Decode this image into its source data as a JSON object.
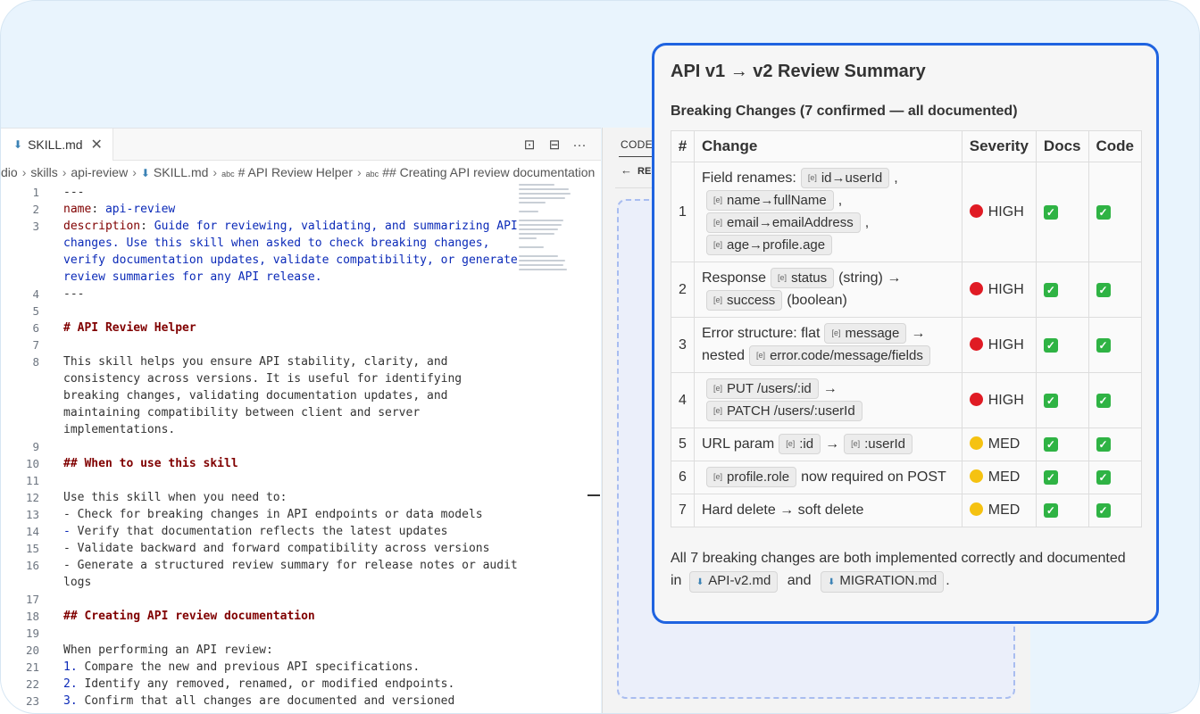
{
  "editor": {
    "tab": {
      "label": "SKILL.md",
      "close": "✕"
    },
    "actions": [
      "⊡",
      "⊟",
      "···"
    ],
    "breadcrumb": [
      {
        "text": "dio"
      },
      {
        "text": "skills"
      },
      {
        "text": "api-review"
      },
      {
        "text": "SKILL.md",
        "icon": "md"
      },
      {
        "text": "# API Review Helper",
        "icon": "abc"
      },
      {
        "text": "## Creating API review documentation",
        "icon": "abc"
      }
    ],
    "lines": [
      {
        "n": "1",
        "parts": [
          {
            "t": "---"
          }
        ]
      },
      {
        "n": "2",
        "parts": [
          {
            "t": "name",
            "c": "k"
          },
          {
            "t": ": "
          },
          {
            "t": "api-review",
            "c": "v"
          }
        ]
      },
      {
        "n": "3",
        "parts": [
          {
            "t": "description",
            "c": "k"
          },
          {
            "t": ": "
          },
          {
            "t": "Guide for reviewing, validating, and summarizing API",
            "c": "v"
          }
        ]
      },
      {
        "n": "",
        "parts": [
          {
            "t": "changes. Use this skill when asked to check breaking changes,",
            "c": "v"
          }
        ]
      },
      {
        "n": "",
        "parts": [
          {
            "t": "verify documentation updates, validate compatibility, or generate",
            "c": "v"
          }
        ]
      },
      {
        "n": "",
        "parts": [
          {
            "t": "review summaries for any API release.",
            "c": "v"
          }
        ]
      },
      {
        "n": "4",
        "parts": [
          {
            "t": "---"
          }
        ]
      },
      {
        "n": "5",
        "parts": []
      },
      {
        "n": "6",
        "parts": [
          {
            "t": "# API Review Helper",
            "c": "h"
          }
        ]
      },
      {
        "n": "7",
        "parts": []
      },
      {
        "n": "8",
        "parts": [
          {
            "t": "This skill helps you ensure API stability, clarity, and"
          }
        ]
      },
      {
        "n": "",
        "parts": [
          {
            "t": "consistency across versions. It is useful for identifying"
          }
        ]
      },
      {
        "n": "",
        "parts": [
          {
            "t": "breaking changes, validating documentation updates, and"
          }
        ]
      },
      {
        "n": "",
        "parts": [
          {
            "t": "maintaining compatibility between client and server"
          }
        ]
      },
      {
        "n": "",
        "parts": [
          {
            "t": "implementations."
          }
        ]
      },
      {
        "n": "9",
        "parts": []
      },
      {
        "n": "10",
        "parts": [
          {
            "t": "## When to use this skill",
            "c": "h"
          }
        ]
      },
      {
        "n": "11",
        "parts": []
      },
      {
        "n": "12",
        "parts": [
          {
            "t": "Use this skill when you need to:"
          }
        ]
      },
      {
        "n": "13",
        "parts": [
          {
            "t": "- Check for breaking changes in API endpoints or data models"
          }
        ]
      },
      {
        "n": "14",
        "parts": [
          {
            "t": "- ",
            "c": "v"
          },
          {
            "t": "Verify that documentation reflects the latest updates"
          }
        ]
      },
      {
        "n": "15",
        "parts": [
          {
            "t": "- Validate backward and forward compatibility across versions"
          }
        ]
      },
      {
        "n": "16",
        "parts": [
          {
            "t": "- Generate a structured review summary for release notes or audit"
          }
        ]
      },
      {
        "n": "",
        "parts": [
          {
            "t": "logs"
          }
        ]
      },
      {
        "n": "17",
        "parts": []
      },
      {
        "n": "18",
        "parts": [
          {
            "t": "## Creating API review documentation",
            "c": "h"
          }
        ]
      },
      {
        "n": "19",
        "parts": []
      },
      {
        "n": "20",
        "parts": [
          {
            "t": "When performing an API review:"
          }
        ]
      },
      {
        "n": "21",
        "parts": [
          {
            "t": "1. ",
            "c": "v"
          },
          {
            "t": "Compare the new and previous API specifications."
          }
        ]
      },
      {
        "n": "22",
        "parts": [
          {
            "t": "2. ",
            "c": "v"
          },
          {
            "t": "Identify any removed, renamed, or modified endpoints."
          }
        ]
      },
      {
        "n": "23",
        "parts": [
          {
            "t": "3. ",
            "c": "v"
          },
          {
            "t": "Confirm that all changes are documented and versioned"
          }
        ]
      }
    ]
  },
  "side_panel": {
    "tab_label": "CODE",
    "back_label": "RE"
  },
  "summary": {
    "title": "API v1 → v2 Review Summary",
    "subtitle": "Breaking Changes (7 confirmed — all documented)",
    "headers": [
      "#",
      "Change",
      "Severity",
      "Docs",
      "Code"
    ],
    "rows": [
      {
        "num": "1",
        "change": [
          {
            "t": "Field renames:"
          },
          {
            "chip": "id→userId"
          },
          {
            "t": ","
          },
          {
            "chip": "name→fullName"
          },
          {
            "t": ","
          },
          {
            "chip": "email→emailAddress"
          },
          {
            "t": ","
          },
          {
            "chip": "age→profile.age"
          }
        ],
        "severity": "HIGH",
        "level": "high",
        "docs": "✓",
        "code": "✓"
      },
      {
        "num": "2",
        "change": [
          {
            "t": "Response"
          },
          {
            "chip": "status"
          },
          {
            "t": "(string) →"
          },
          {
            "chip": "success"
          },
          {
            "t": "(boolean)"
          }
        ],
        "severity": "HIGH",
        "level": "high",
        "docs": "✓",
        "code": "✓"
      },
      {
        "num": "3",
        "change": [
          {
            "t": "Error structure: flat"
          },
          {
            "chip": "message"
          },
          {
            "t": "→ nested"
          },
          {
            "chip": "error.code/message/fields"
          }
        ],
        "severity": "HIGH",
        "level": "high",
        "docs": "✓",
        "code": "✓"
      },
      {
        "num": "4",
        "change": [
          {
            "chip": "PUT /users/:id"
          },
          {
            "t": "→"
          },
          {
            "chip": "PATCH /users/:userId"
          }
        ],
        "severity": "HIGH",
        "level": "high",
        "docs": "✓",
        "code": "✓"
      },
      {
        "num": "5",
        "change": [
          {
            "t": "URL param"
          },
          {
            "chip": ":id"
          },
          {
            "t": "→"
          },
          {
            "chip": ":userId"
          }
        ],
        "severity": "MED",
        "level": "med",
        "docs": "✓",
        "code": "✓"
      },
      {
        "num": "6",
        "change": [
          {
            "chip": "profile.role"
          },
          {
            "t": "now required on POST"
          }
        ],
        "severity": "MED",
        "level": "med",
        "docs": "✓",
        "code": "✓"
      },
      {
        "num": "7",
        "change": [
          {
            "t": "Hard delete → soft delete"
          }
        ],
        "severity": "MED",
        "level": "med",
        "docs": "✓",
        "code": "✓"
      }
    ],
    "footer": {
      "before": "All 7 breaking changes are both implemented correctly and documented in",
      "file1": "API-v2.md",
      "between": "and",
      "file2": "MIGRATION.md",
      "after": "."
    }
  },
  "colors": {
    "accent": "#1f63e0",
    "high": "#e01b24",
    "med": "#f5c211",
    "check": "#2fb344"
  }
}
